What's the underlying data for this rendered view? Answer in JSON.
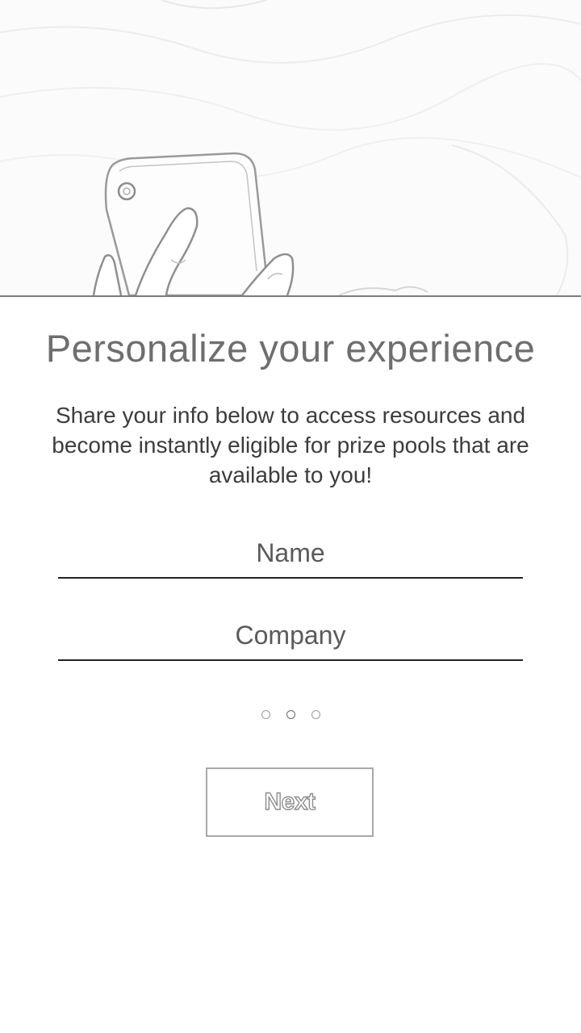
{
  "hero": {
    "illustration": "hand-holding-phone-illustration"
  },
  "main": {
    "title": "Personalize your experience",
    "subtitle": "Share your info below to access resources and become instantly eligible for prize pools that are available to you!"
  },
  "form": {
    "name_placeholder": "Name",
    "name_value": "",
    "company_placeholder": "Company",
    "company_value": ""
  },
  "pager": {
    "total_pages": 3,
    "current_page": 2
  },
  "actions": {
    "next_label": "Next"
  }
}
